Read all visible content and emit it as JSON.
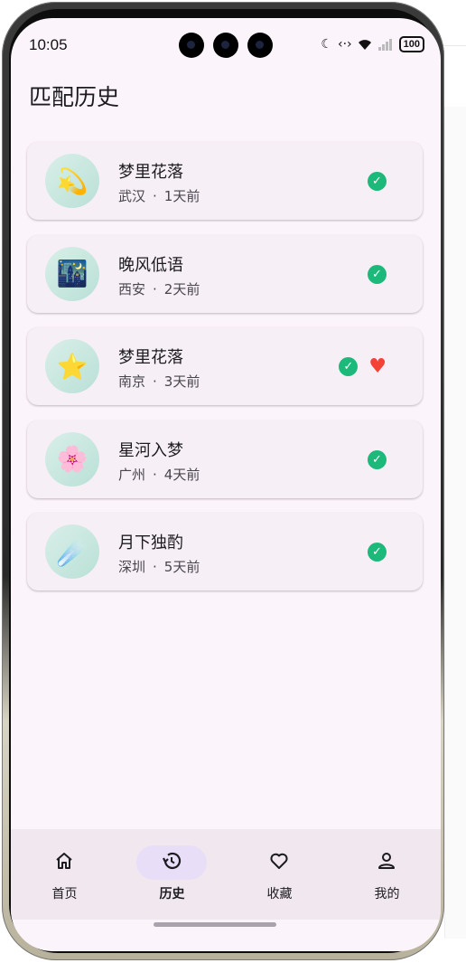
{
  "status_bar": {
    "time": "10:05",
    "battery": "100"
  },
  "header": {
    "title": "匹配历史"
  },
  "matches": [
    {
      "name": "梦里花落",
      "city": "武汉",
      "separator": "·",
      "ago": "1天前",
      "avatar_emoji": "💫",
      "matched": true,
      "liked": false
    },
    {
      "name": "晚风低语",
      "city": "西安",
      "separator": "·",
      "ago": "2天前",
      "avatar_emoji": "🌃",
      "matched": true,
      "liked": false
    },
    {
      "name": "梦里花落",
      "city": "南京",
      "separator": "·",
      "ago": "3天前",
      "avatar_emoji": "⭐",
      "matched": true,
      "liked": true
    },
    {
      "name": "星河入梦",
      "city": "广州",
      "separator": "·",
      "ago": "4天前",
      "avatar_emoji": "🌸",
      "matched": true,
      "liked": false
    },
    {
      "name": "月下独酌",
      "city": "深圳",
      "separator": "·",
      "ago": "5天前",
      "avatar_emoji": "☄️",
      "matched": true,
      "liked": false
    }
  ],
  "nav": [
    {
      "label": "首页",
      "icon": "home-icon",
      "active": false
    },
    {
      "label": "历史",
      "icon": "history-icon",
      "active": true
    },
    {
      "label": "收藏",
      "icon": "heart-outline-icon",
      "active": false
    },
    {
      "label": "我的",
      "icon": "person-icon",
      "active": false
    }
  ],
  "colors": {
    "check": "#1db97a",
    "heart": "#f24336",
    "active_pill": "#e8def7",
    "background": "#fcf4fb"
  }
}
